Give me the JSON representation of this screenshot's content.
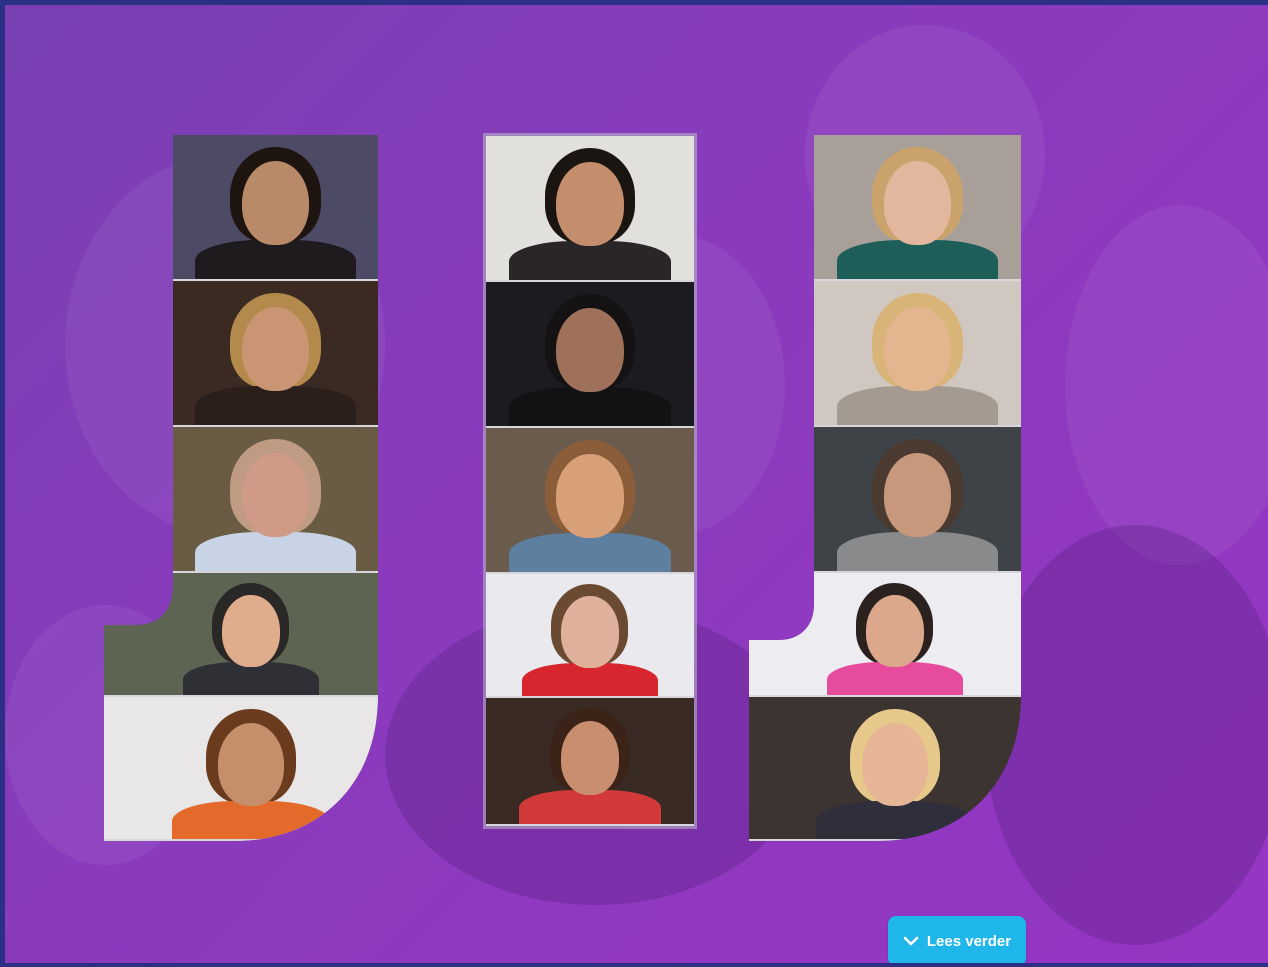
{
  "cta": {
    "label": "Lees verder",
    "icon": "chevron-down-icon",
    "color": "#1fb6ea"
  },
  "background_color": "#8a3bbd",
  "columns": [
    {
      "name": "left",
      "photos": [
        {
          "bg": "#4d4a66",
          "skin": "#b98a68",
          "hair": "#1e1410",
          "top": "#1f1a1e"
        },
        {
          "bg": "#3b2a22",
          "skin": "#c99572",
          "hair": "#b48a4c",
          "top": "#2a1f1a"
        },
        {
          "bg": "#6a5b44",
          "skin": "#cf9a86",
          "hair": "#c09b83",
          "top": "#c8d3e6"
        },
        {
          "bg": "#5d6552",
          "skin": "#e0ad8c",
          "hair": "#2a2727",
          "top": "#2f3036"
        },
        {
          "bg": "#e8e6e6",
          "skin": "#c58f6c",
          "hair": "#6a3b1c",
          "top": "#e36a2a"
        }
      ]
    },
    {
      "name": "middle",
      "photos": [
        {
          "bg": "#e2e0dd",
          "skin": "#c48e6d",
          "hair": "#1b1512",
          "top": "#2a2528"
        },
        {
          "bg": "#1c1c20",
          "skin": "#a0715a",
          "hair": "#141213",
          "top": "#121214"
        },
        {
          "bg": "#6b5b4d",
          "skin": "#d7a079",
          "hair": "#8b5d38",
          "top": "#5d7fa0"
        },
        {
          "bg": "#e9e9ee",
          "skin": "#e0b19a",
          "hair": "#6b4a32",
          "top": "#d8262e"
        },
        {
          "bg": "#3a2a24",
          "skin": "#c88e6e",
          "hair": "#3b2317",
          "top": "#d23a3a"
        }
      ]
    },
    {
      "name": "right",
      "photos": [
        {
          "bg": "#a8a098",
          "skin": "#e3b79d",
          "hair": "#c9a36b",
          "top": "#1d5f58"
        },
        {
          "bg": "#cfc7c0",
          "skin": "#e4b690",
          "hair": "#d8b478",
          "top": "#a59a90"
        },
        {
          "bg": "#3e4348",
          "skin": "#c8987d",
          "hair": "#4b3a2f",
          "top": "#8a8a8c"
        },
        {
          "bg": "#ececf1",
          "skin": "#dca88b",
          "hair": "#2b2220",
          "top": "#e64b9c"
        },
        {
          "bg": "#3c3431",
          "skin": "#e5b596",
          "hair": "#e6c98a",
          "top": "#2e2f3a"
        }
      ]
    }
  ]
}
